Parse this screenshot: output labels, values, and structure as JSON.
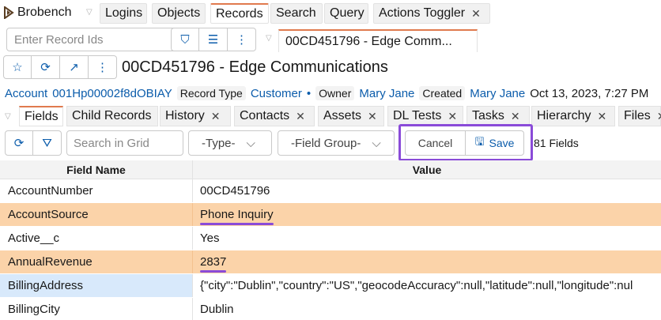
{
  "app": {
    "brand": "Brobench",
    "tabs": [
      {
        "label": "Logins"
      },
      {
        "label": "Objects"
      },
      {
        "label": "Records"
      },
      {
        "label": "Search"
      },
      {
        "label": "Query"
      },
      {
        "label": "Actions Toggler"
      }
    ]
  },
  "record_bar": {
    "placeholder": "Enter Record Ids",
    "open_tab": "00CD451796 - Edge Comm..."
  },
  "record": {
    "title": "00CD451796 - Edge Communications",
    "object": "Account",
    "id": "001Hp00002f8dOBIAY",
    "record_type_label": "Record Type",
    "record_type": "Customer",
    "owner_label": "Owner",
    "owner": "Mary Jane",
    "created_label": "Created",
    "created_by": "Mary Jane",
    "created_at": "Oct 13, 2023, 7:27 PM"
  },
  "subtabs": [
    {
      "label": "Fields"
    },
    {
      "label": "Child Records"
    },
    {
      "label": "History"
    },
    {
      "label": "Contacts"
    },
    {
      "label": "Assets"
    },
    {
      "label": "DL Tests"
    },
    {
      "label": "Tasks"
    },
    {
      "label": "Hierarchy"
    },
    {
      "label": "Files"
    }
  ],
  "toolbar": {
    "search_placeholder": "Search in Grid",
    "type_select": "-Type-",
    "field_group_select": "-Field Group-",
    "cancel_label": "Cancel",
    "save_label": "Save",
    "count": "81 Fields"
  },
  "grid": {
    "headers": [
      "Field Name",
      "Value"
    ],
    "rows": [
      {
        "name": "AccountNumber",
        "value": "00CD451796"
      },
      {
        "name": "AccountSource",
        "value": "Phone Inquiry"
      },
      {
        "name": "Active__c",
        "value": "Yes"
      },
      {
        "name": "AnnualRevenue",
        "value": "2837"
      },
      {
        "name": "BillingAddress",
        "value": "{\"city\":\"Dublin\",\"country\":\"US\",\"geocodeAccuracy\":null,\"latitude\":null,\"longitude\":nul"
      },
      {
        "name": "BillingCity",
        "value": "Dublin"
      }
    ]
  },
  "colors": {
    "accent": "#e07a4e",
    "link": "#0b5cab",
    "modified_row": "#fbd3a9",
    "selected_cell": "#d8e9fb",
    "highlight": "#8a4bd8"
  }
}
